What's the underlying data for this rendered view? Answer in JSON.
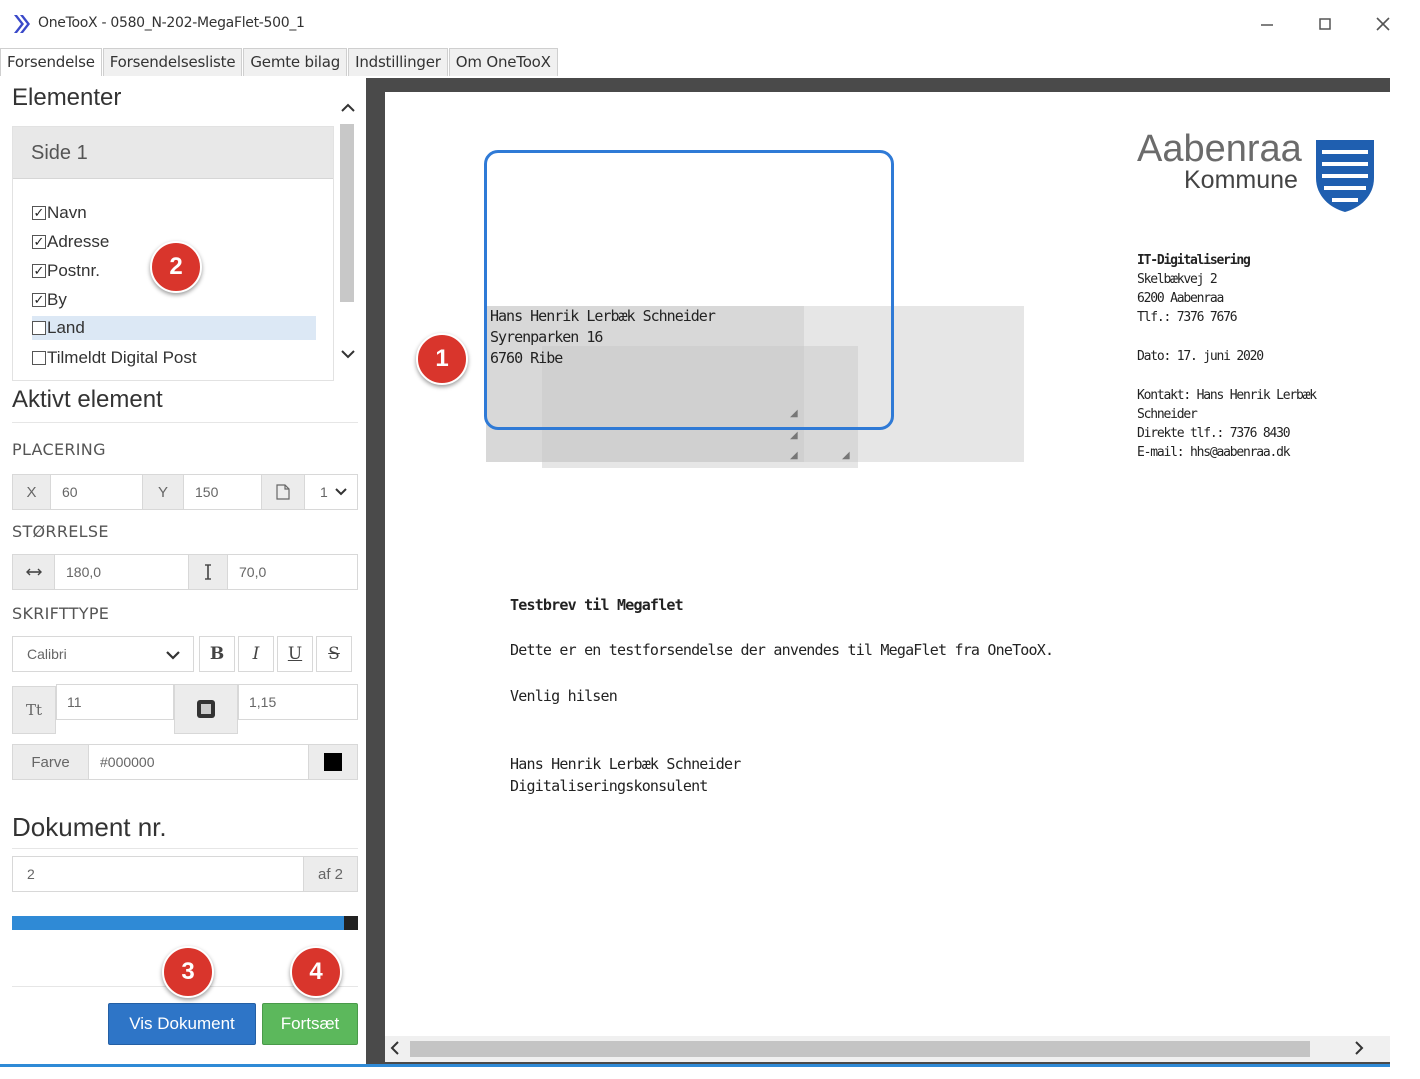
{
  "window": {
    "title": "OneTooX - 0580_N-202-MegaFlet-500_1",
    "minimize": "—",
    "maximize": "☐",
    "close": "✕"
  },
  "tabs": [
    "Forsendelse",
    "Forsendelsesliste",
    "Gemte bilag",
    "Indstillinger",
    "Om OneTooX"
  ],
  "left": {
    "elementer_heading": "Elementer",
    "side_header": "Side 1",
    "elements": [
      {
        "label": "Navn",
        "checked": true
      },
      {
        "label": "Adresse",
        "checked": true
      },
      {
        "label": "Postnr.",
        "checked": true
      },
      {
        "label": "By",
        "checked": true
      },
      {
        "label": "Land",
        "checked": false
      },
      {
        "label": "Tilmeldt Digital Post",
        "checked": false
      }
    ],
    "aktivt_heading": "Aktivt element",
    "placering_label": "PLACERING",
    "x_label": "X",
    "x_value": "60",
    "y_label": "Y",
    "y_value": "150",
    "page_select": "1",
    "stoerrelse_label": "STØRRELSE",
    "width_value": "180,0",
    "height_value": "70,0",
    "skrifttype_label": "SKRIFTTYPE",
    "font_value": "Calibri",
    "bold_btn": "B",
    "italic_btn": "I",
    "underline_btn": "U",
    "strike_btn": "S",
    "size_icon_text": "Tt",
    "font_size_value": "11",
    "line_height_value": "1,15",
    "farve_label": "Farve",
    "farve_value": "#000000",
    "swatch_color": "#000000",
    "dokument_heading": "Dokument nr.",
    "dokument_value": "2",
    "dokument_total": "af 2",
    "progress_fraction": 1.0,
    "vis_dokument_btn": "Vis Dokument",
    "fortsaet_btn": "Fortsæt"
  },
  "callouts": [
    "1",
    "2",
    "3",
    "4"
  ],
  "document": {
    "address_lines": [
      "Hans Henrik Lerbæk Schneider",
      "Syrenparken 16",
      "6760   Ribe"
    ],
    "logo_name": "Aabenraa",
    "logo_sub": "Kommune",
    "sender_dept": "IT-Digitalisering",
    "sender_lines": [
      "Skelbækvej 2",
      "6200 Aabenraa",
      "Tlf.: 7376 7676"
    ],
    "date_line": "Dato: 17. juni 2020",
    "contact_lines": [
      "Kontakt: Hans Henrik Lerbæk",
      "Schneider",
      "Direkte tlf.: 7376 8430",
      "E-mail: hhs@aabenraa.dk"
    ],
    "subject": "Testbrev til Megaflet",
    "body": "Dette er en testforsendelse der anvendes til MegaFlet fra OneTooX.",
    "greeting": "Venlig hilsen",
    "signature_name": "Hans Henrik Lerbæk Schneider",
    "signature_title": "Digitaliseringskonsulent"
  },
  "colors": {
    "accent_blue": "#2e75c7",
    "accent_green": "#5cb85c",
    "callout_red": "#d9352c"
  }
}
